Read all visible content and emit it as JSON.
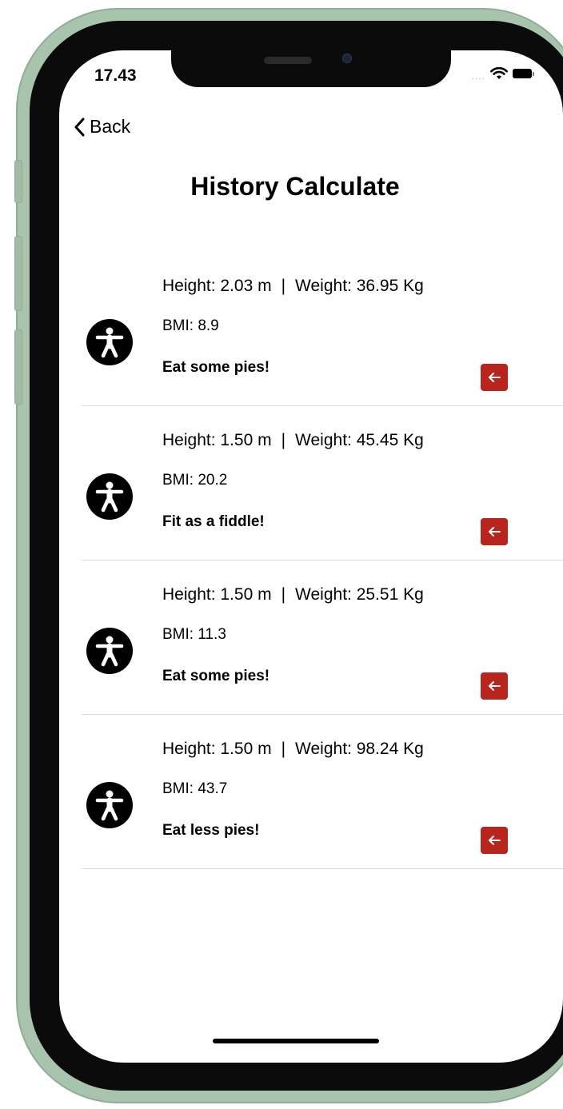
{
  "status_bar": {
    "time": "17.43",
    "signal": "....",
    "wifi_icon": "wifi-icon",
    "battery_icon": "battery-icon"
  },
  "nav": {
    "back_label": "Back",
    "back_icon": "chevron-left-icon"
  },
  "page": {
    "title": "History Calculate"
  },
  "history": [
    {
      "height": "Height: 2.03 m",
      "separator": "|",
      "weight": "Weight: 36.95 Kg",
      "bmi": "BMI: 8.9",
      "message": "Eat some pies!"
    },
    {
      "height": "Height: 1.50 m",
      "separator": "|",
      "weight": "Weight: 45.45 Kg",
      "bmi": "BMI: 20.2",
      "message": "Fit as a fiddle!"
    },
    {
      "height": "Height: 1.50 m",
      "separator": "|",
      "weight": "Weight: 25.51 Kg",
      "bmi": "BMI: 11.3",
      "message": "Eat some pies!"
    },
    {
      "height": "Height: 1.50 m",
      "separator": "|",
      "weight": "Weight: 98.24 Kg",
      "bmi": "BMI: 43.7",
      "message": "Eat less pies!"
    }
  ],
  "icons": {
    "row_icon": "accessibility-person-icon",
    "delete_icon": "arrow-left-icon"
  },
  "colors": {
    "delete_button": "#b8251d",
    "phone_frame": "#a9c4ad"
  }
}
